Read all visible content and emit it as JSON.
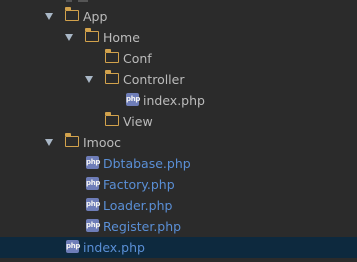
{
  "colors": {
    "background": "#2b2b2b",
    "selection": "#0d293e",
    "folder": "#d2a24c",
    "php_badge": "#6e7db8",
    "class_text": "#5a8fd6",
    "plain_text": "#bbbbbb"
  },
  "icons": {
    "php_badge_text": "php"
  },
  "tree": {
    "app": {
      "label": "App",
      "icon": "folder-icon",
      "expanded": true
    },
    "home": {
      "label": "Home",
      "icon": "folder-icon",
      "expanded": true
    },
    "conf": {
      "label": "Conf",
      "icon": "folder-icon"
    },
    "controller": {
      "label": "Controller",
      "icon": "folder-icon",
      "expanded": true
    },
    "controller_index": {
      "label": "index.php",
      "icon": "php-file-icon"
    },
    "view": {
      "label": "View",
      "icon": "folder-icon"
    },
    "imooc": {
      "label": "Imooc",
      "icon": "folder-icon",
      "expanded": true
    },
    "dbtabase": {
      "label": "Dbtabase.php",
      "icon": "php-class-icon"
    },
    "factory": {
      "label": "Factory.php",
      "icon": "php-class-icon"
    },
    "loader": {
      "label": "Loader.php",
      "icon": "php-class-icon"
    },
    "register": {
      "label": "Register.php",
      "icon": "php-class-icon"
    },
    "root_index": {
      "label": "index.php",
      "icon": "php-file-icon",
      "selected": true
    }
  }
}
